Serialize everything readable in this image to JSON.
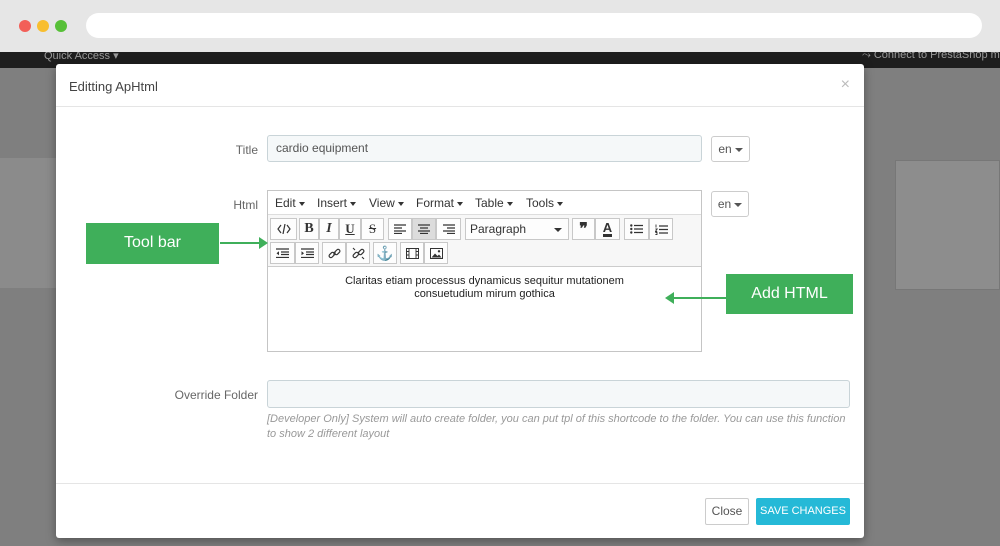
{
  "colors": {
    "accent": "#25b9d7",
    "annotation": "#3faf5a"
  },
  "topbar": {
    "quick_access": "Quick Access ▾",
    "connect": "⤳ Connect to PrestaShop m"
  },
  "modal": {
    "title": "Editting ApHtml",
    "close_icon": "×",
    "fields": {
      "title_label": "Title",
      "title_value": "cardio equipment",
      "lang": "en",
      "html_label": "Html",
      "override_label": "Override Folder",
      "override_value": "",
      "help_text": "[Developer Only] System will auto create folder, you can put tpl of this shortcode to the folder. You can use this function to show 2 different layout"
    },
    "editor": {
      "menus": [
        "Edit",
        "Insert",
        "View",
        "Format",
        "Table",
        "Tools"
      ],
      "format_value": "Paragraph",
      "content_line1": "Claritas etiam processus dynamicus sequitur mutationem",
      "content_line2": "consuetudium mirum gothica"
    },
    "footer": {
      "close_label": "Close",
      "save_label": "SAVE CHANGES"
    }
  },
  "annotations": {
    "toolbar": "Tool bar",
    "add_html": "Add HTML"
  }
}
